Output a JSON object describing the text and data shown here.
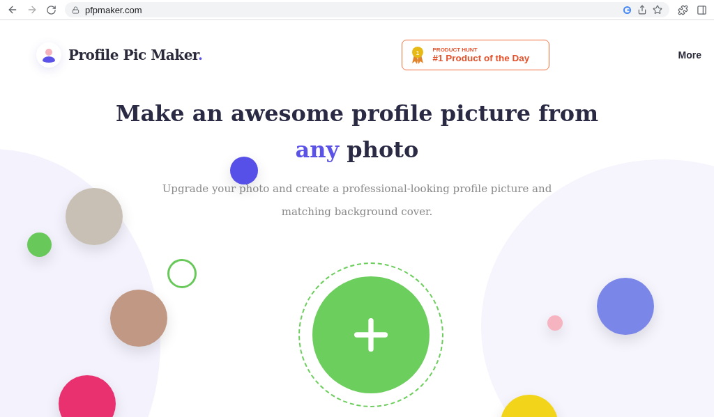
{
  "browser": {
    "url": "pfpmaker.com"
  },
  "header": {
    "logo": "Profile Pic Maker",
    "logo_dot": ".",
    "badge": {
      "medal": "1",
      "kicker": "PRODUCT HUNT",
      "title": "#1 Product of the Day"
    },
    "menu": "More"
  },
  "hero": {
    "headline": {
      "before": "Make an awesome profile picture from",
      "highlight": "any",
      "after": "photo"
    },
    "subtitle": "Upgrade your photo and create a professional-looking profile picture and matching background cover."
  }
}
